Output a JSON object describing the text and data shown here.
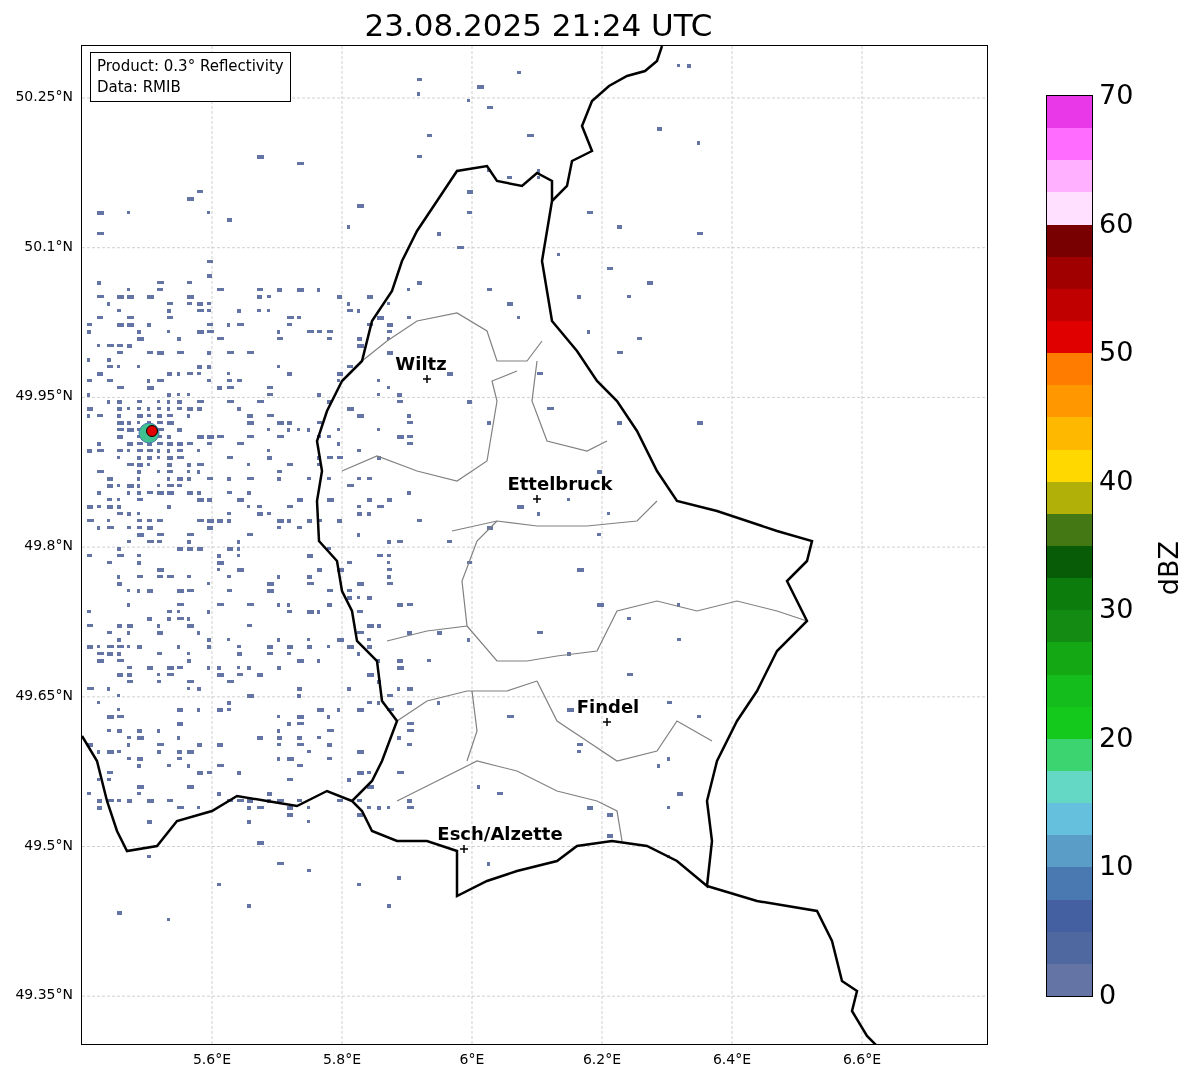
{
  "title": "23.08.2025 21:24 UTC",
  "map": {
    "legend": [
      "Product: 0.3° Reflectivity",
      "Data: RMIB"
    ],
    "cities": [
      {
        "name": "Wiltz"
      },
      {
        "name": "Ettelbruck"
      },
      {
        "name": "Findel"
      },
      {
        "name": "Esch/Alzette"
      }
    ],
    "y_ticks": [
      "50.25°N",
      "50.1°N",
      "49.95°N",
      "49.8°N",
      "49.65°N",
      "49.5°N",
      "49.35°N"
    ],
    "x_ticks": [
      "5.6°E",
      "5.8°E",
      "6°E",
      "6.2°E",
      "6.4°E",
      "6.6°E"
    ]
  },
  "colorbar": {
    "label": "dBZ",
    "ticks": [
      "70",
      "60",
      "50",
      "40",
      "30",
      "20",
      "10",
      "0"
    ],
    "segments": [
      {
        "color": "#6474a4"
      },
      {
        "color": "#5068a0"
      },
      {
        "color": "#4460a0"
      },
      {
        "color": "#4a78b0"
      },
      {
        "color": "#5a9ec8"
      },
      {
        "color": "#64c0dc"
      },
      {
        "color": "#64d8c4"
      },
      {
        "color": "#3cd470"
      },
      {
        "color": "#14c81c"
      },
      {
        "color": "#14bc1c"
      },
      {
        "color": "#14a814"
      },
      {
        "color": "#148c14"
      },
      {
        "color": "#0c7c0c"
      },
      {
        "color": "#085c08"
      },
      {
        "color": "#447814"
      },
      {
        "color": "#b0b008"
      },
      {
        "color": "#ffd800"
      },
      {
        "color": "#ffb800"
      },
      {
        "color": "#ff9800"
      },
      {
        "color": "#ff7c00"
      },
      {
        "color": "#e00000"
      },
      {
        "color": "#c00000"
      },
      {
        "color": "#a00000"
      },
      {
        "color": "#780000"
      },
      {
        "color": "#ffe0ff"
      },
      {
        "color": "#ffb0ff"
      },
      {
        "color": "#ff6cff"
      },
      {
        "color": "#e838e8"
      }
    ]
  }
}
